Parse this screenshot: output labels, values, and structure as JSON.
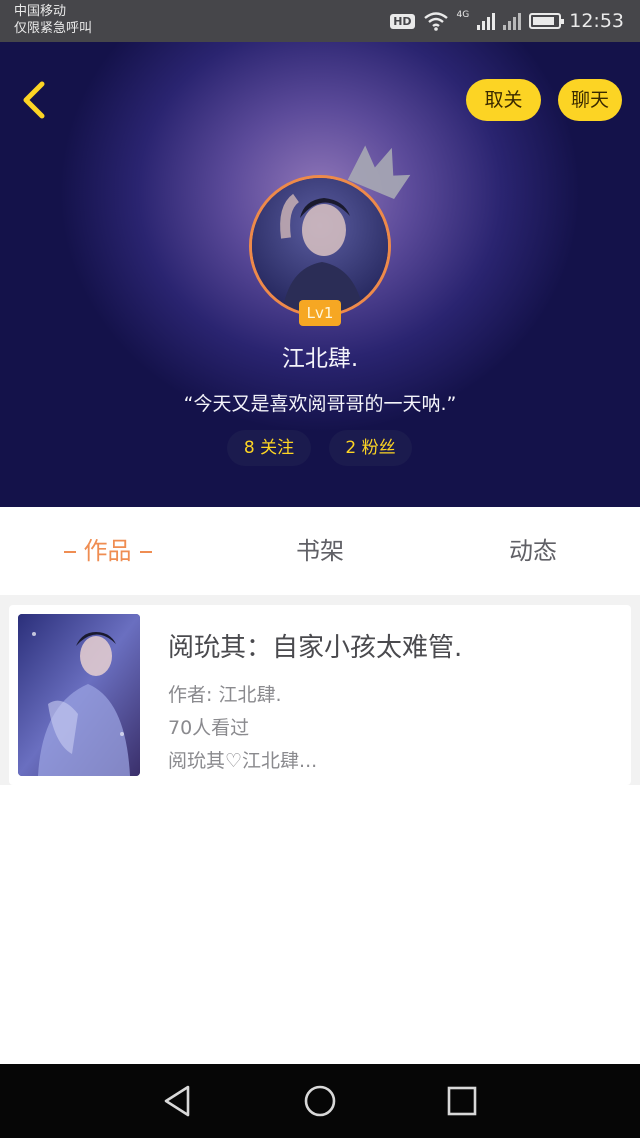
{
  "status_bar": {
    "carrier": "中国移动",
    "emergency": "仅限紧急呼叫",
    "network_badge": "HD",
    "network_type": "4G",
    "time": "12:53",
    "battery_level": 0.85
  },
  "header": {
    "unfollow_label": "取关",
    "chat_label": "聊天",
    "level": "Lv1",
    "username": "江北肆.",
    "bio": "“今天又是喜欢阅哥哥的一天呐.”",
    "following_label": "8 关注",
    "fans_label": "2 粉丝"
  },
  "tabs": [
    {
      "label": "作品",
      "active": true
    },
    {
      "label": "书架",
      "active": false
    },
    {
      "label": "动态",
      "active": false
    }
  ],
  "works": [
    {
      "title": "阅玧其：自家小孩太难管.",
      "author": "作者: 江北肆.",
      "views": "70人看过",
      "tags": "阅玧其♡江北肆..."
    }
  ],
  "colors": {
    "accent": "#fcd424",
    "tab_active": "#ef8d52",
    "avatar_ring": "#ee8a4a"
  },
  "icons": [
    "back-arrow-icon",
    "crown-icon",
    "wifi-icon",
    "signal-icon",
    "battery-icon",
    "nav-back-icon",
    "nav-home-icon",
    "nav-recents-icon"
  ]
}
